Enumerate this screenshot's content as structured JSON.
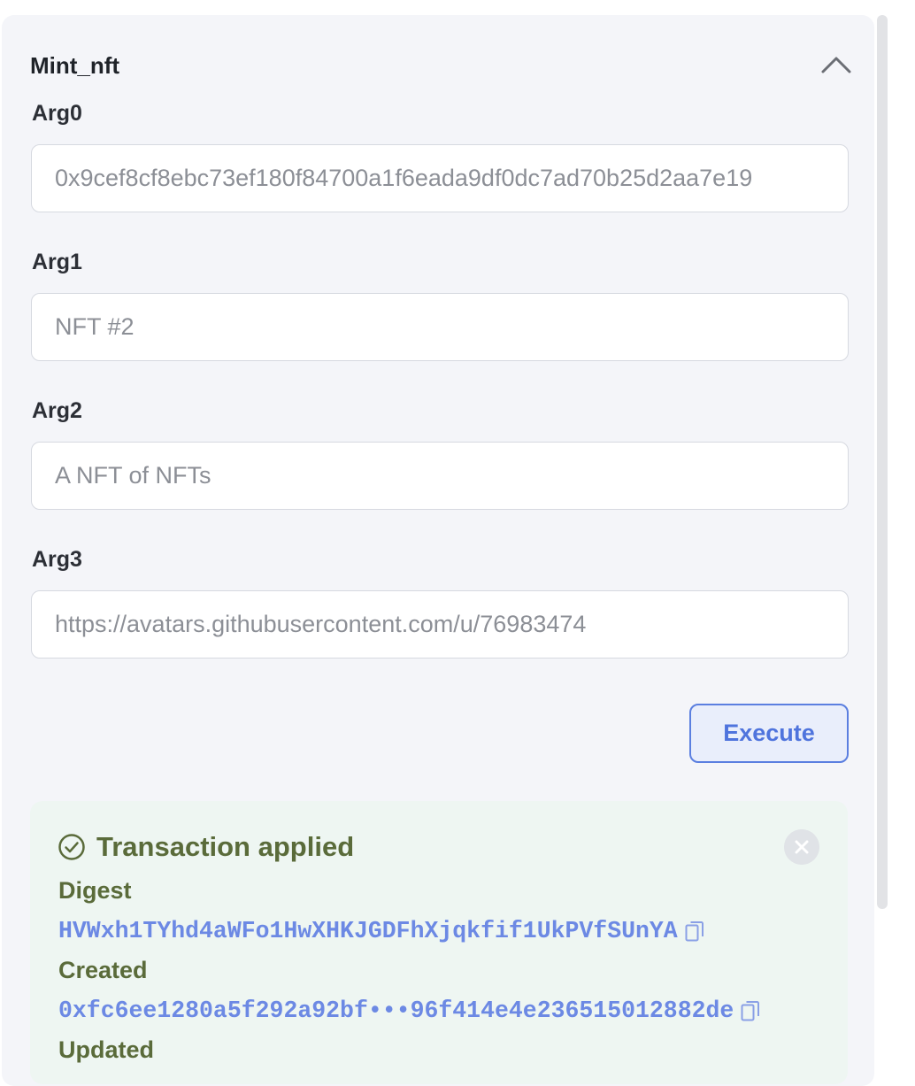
{
  "panel": {
    "title": "Mint_nft"
  },
  "args": [
    {
      "label": "Arg0",
      "value": "0x9cef8cf8ebc73ef180f84700a1f6eada9df0dc7ad70b25d2aa7e19"
    },
    {
      "label": "Arg1",
      "value": "NFT #2"
    },
    {
      "label": "Arg2",
      "value": "A NFT of NFTs"
    },
    {
      "label": "Arg3",
      "value": "https://avatars.githubusercontent.com/u/76983474"
    }
  ],
  "execute_label": "Execute",
  "transaction": {
    "status": "Transaction applied",
    "digest_label": "Digest",
    "digest_value": "HVWxh1TYhd4aWFo1HwXHKJGDFhXjqkfif1UkPVfSUnYA",
    "created_label": "Created",
    "created_value": "0xfc6ee1280a5f292a92bf•••96f414e4e236515012882de",
    "updated_label": "Updated"
  },
  "colors": {
    "accent": "#4f74dd",
    "success_text": "#5a6b3a",
    "success_bg": "#eef6f2",
    "panel_bg": "#f4f5f9"
  },
  "icons": {
    "collapse": "chevron-up-icon",
    "status": "check-circle-icon",
    "close": "close-icon",
    "copy": "copy-icon"
  }
}
